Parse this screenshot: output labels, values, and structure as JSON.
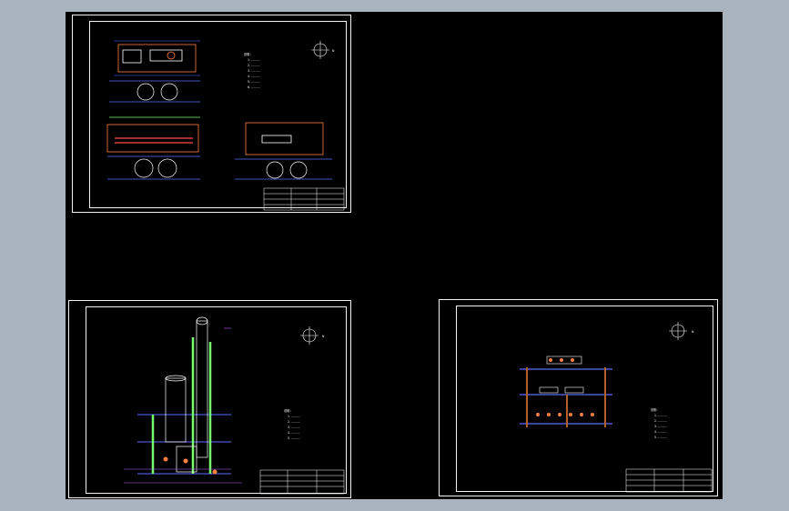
{
  "app": {
    "colors": {
      "background": "#a9b3be",
      "viewport": "#000000",
      "frame": "#f2f2f2",
      "equipment": "#ff7f3f",
      "dimension": "#ff4d4d",
      "structure_blue": "#5b6cff",
      "structure_green": "#78ff6e",
      "pipe_magenta": "#c060ff",
      "annotation_cyan": "#5fd7ff",
      "column_brown": "#b0602a"
    }
  },
  "sheets": [
    {
      "id": "sheet-1",
      "notes_title": "说明：",
      "notes": [
        "1. ..........",
        "2. ..........",
        "3. ..........",
        "4. ..........",
        "5. ..........",
        "6. .........."
      ],
      "north_label": "N",
      "title_block": [
        "",
        "",
        "",
        ""
      ]
    },
    {
      "id": "sheet-2",
      "notes_title": "说明：",
      "notes": [
        "1. ..........",
        "2. ..........",
        "3. ..........",
        "4. ..........",
        "5. .........."
      ],
      "north_label": "N",
      "title_block": [
        "",
        "",
        "",
        ""
      ]
    },
    {
      "id": "sheet-3",
      "notes_title": "说明：",
      "notes": [
        "1. ..........",
        "2. ..........",
        "3. ..........",
        "4. ..........",
        "5. .........."
      ],
      "north_label": "N",
      "title_block": [
        "",
        "",
        "",
        ""
      ]
    }
  ]
}
